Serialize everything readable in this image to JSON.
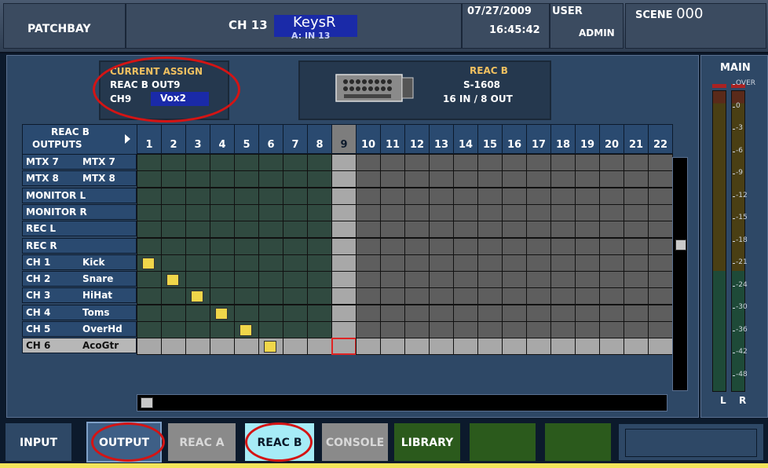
{
  "header": {
    "patchbay_label": "PATCHBAY",
    "channel_label": "CH 13",
    "channel_name": "KeysR",
    "channel_input": "A: IN 13",
    "date": "07/27/2009",
    "time": "16:45:42",
    "user_label": "USER",
    "user_value": "ADMIN",
    "scene_label": "SCENE",
    "scene_number": "000"
  },
  "current_assign": {
    "title": "CURRENT ASSIGN",
    "output": "REAC B OUT9",
    "channel": "CH9",
    "channel_name": "Vox2"
  },
  "device": {
    "title": "REAC B",
    "model": "S-1608",
    "io": "16 IN /  8 OUT"
  },
  "grid": {
    "corner_line1": "REAC B",
    "corner_line2": "OUTPUTS",
    "columns": [
      "1",
      "2",
      "3",
      "4",
      "5",
      "6",
      "7",
      "8",
      "9",
      "10",
      "11",
      "12",
      "13",
      "14",
      "15",
      "16",
      "17",
      "18",
      "19",
      "20",
      "21",
      "22"
    ],
    "selected_column": "9",
    "rows": [
      {
        "a": "MTX 7",
        "b": "MTX 7"
      },
      {
        "a": "MTX 8",
        "b": "MTX 8"
      },
      {
        "a": "MONITOR L",
        "b": ""
      },
      {
        "a": "MONITOR R",
        "b": ""
      },
      {
        "a": "REC L",
        "b": ""
      },
      {
        "a": "REC R",
        "b": ""
      },
      {
        "a": "CH 1",
        "b": "Kick"
      },
      {
        "a": "CH 2",
        "b": "Snare"
      },
      {
        "a": "CH 3",
        "b": "HiHat"
      },
      {
        "a": "CH 4",
        "b": "Toms"
      },
      {
        "a": "CH 5",
        "b": "OverHd"
      },
      {
        "a": "CH 6",
        "b": "AcoGtr"
      }
    ],
    "selected_row": "CH 6",
    "patches": [
      {
        "row": "CH 1",
        "column": "1"
      },
      {
        "row": "CH 2",
        "column": "2"
      },
      {
        "row": "CH 3",
        "column": "3"
      },
      {
        "row": "CH 4",
        "column": "4"
      },
      {
        "row": "CH 5",
        "column": "5"
      },
      {
        "row": "CH 6",
        "column": "6"
      }
    ],
    "cursor": {
      "row": "CH 6",
      "column": "9"
    }
  },
  "meter": {
    "title": "MAIN",
    "ticks": [
      "OVER",
      "0",
      "-3",
      "-6",
      "-9",
      "-12",
      "-15",
      "-18",
      "-21",
      "-24",
      "-30",
      "-36",
      "-42",
      "-48"
    ],
    "left_label": "L",
    "right_label": "R"
  },
  "tabs": [
    {
      "label": "INPUT",
      "style": "blue"
    },
    {
      "label": "OUTPUT",
      "style": "active"
    },
    {
      "label": "REAC A",
      "style": "grey"
    },
    {
      "label": "REAC B",
      "style": "cyan"
    },
    {
      "label": "CONSOLE",
      "style": "grey"
    },
    {
      "label": "LIBRARY",
      "style": "green"
    },
    {
      "label": "",
      "style": "green"
    },
    {
      "label": "",
      "style": "green"
    }
  ],
  "colors": {
    "accent_blue": "#1a2aa8",
    "patch_yellow": "#f0d64a",
    "annotation_red": "#d41414",
    "selected_tab_cyan": "#a6ecf7"
  }
}
